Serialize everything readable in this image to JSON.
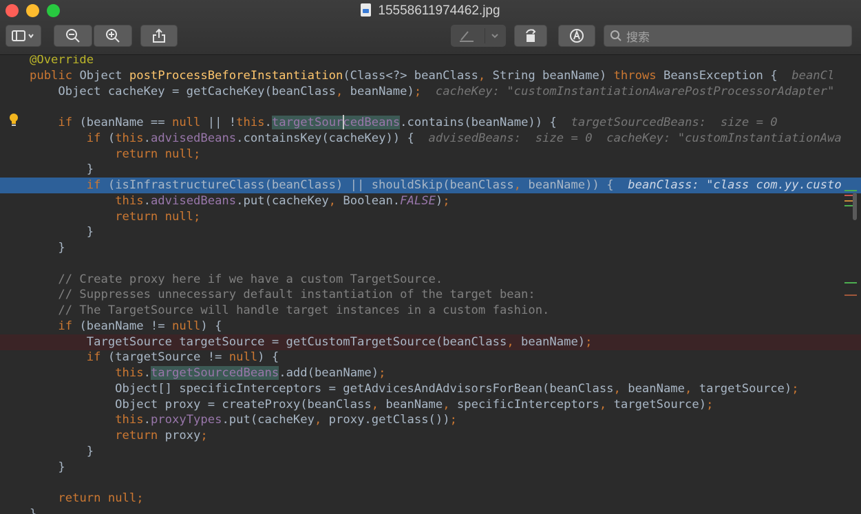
{
  "window": {
    "title": "15558611974462.jpg",
    "search_placeholder": "搜索"
  },
  "toolbar": {
    "icons": [
      "sidebar-icon",
      "zoom-out-icon",
      "zoom-in-icon",
      "share-icon",
      "markup-pen-icon",
      "rotate-icon",
      "annotate-icon"
    ]
  },
  "colors": {
    "keyword": "#cc7832",
    "method": "#ffc66d",
    "field": "#9876aa",
    "comment": "#808080",
    "annotation": "#bbb529",
    "exec_line": "#2d6099",
    "breakpoint_line": "#3b2426",
    "search_highlight": "#3c5a55"
  },
  "code": {
    "lines": [
      {
        "tokens": [
          {
            "c": "ann",
            "t": "@Override"
          }
        ]
      },
      {
        "tokens": [
          {
            "c": "kw",
            "t": "public "
          },
          {
            "c": "pl",
            "t": "Object "
          },
          {
            "c": "fn",
            "t": "postProcessBeforeInstantiation"
          },
          {
            "c": "pl",
            "t": "(Class<?> beanClass"
          },
          {
            "c": "kw",
            "t": ", "
          },
          {
            "c": "pl",
            "t": "String beanName) "
          },
          {
            "c": "kw",
            "t": "throws "
          },
          {
            "c": "pl",
            "t": "BeansException {  "
          },
          {
            "c": "hint",
            "t": "beanCl"
          }
        ]
      },
      {
        "tokens": [
          {
            "c": "pl",
            "t": "    Object cacheKey = getCacheKey(beanClass"
          },
          {
            "c": "kw",
            "t": ", "
          },
          {
            "c": "pl",
            "t": "beanName)"
          },
          {
            "c": "kw",
            "t": ";  "
          },
          {
            "c": "hint",
            "t": "cacheKey: \"customInstantiationAwarePostProcessorAdapter\""
          }
        ]
      },
      {
        "tokens": []
      },
      {
        "tokens": [
          {
            "c": "pl",
            "t": "    "
          },
          {
            "c": "kw",
            "t": "if "
          },
          {
            "c": "pl",
            "t": "(beanName == "
          },
          {
            "c": "kw",
            "t": "null "
          },
          {
            "c": "pl",
            "t": "|| !"
          },
          {
            "c": "kw",
            "t": "this"
          },
          {
            "c": "pl",
            "t": "."
          },
          {
            "c": "fld hl",
            "t": "targetSourcedBeans"
          },
          {
            "c": "pl",
            "t": ".contains(beanName)) {  "
          },
          {
            "c": "hint",
            "t": "targetSourcedBeans:  size = 0"
          }
        ]
      },
      {
        "tokens": [
          {
            "c": "pl",
            "t": "        "
          },
          {
            "c": "kw",
            "t": "if "
          },
          {
            "c": "pl",
            "t": "("
          },
          {
            "c": "kw",
            "t": "this"
          },
          {
            "c": "pl",
            "t": "."
          },
          {
            "c": "fld",
            "t": "advisedBeans"
          },
          {
            "c": "pl",
            "t": ".containsKey(cacheKey)) {  "
          },
          {
            "c": "hint",
            "t": "advisedBeans:  size = 0  cacheKey: \"customInstantiationAwa"
          }
        ]
      },
      {
        "tokens": [
          {
            "c": "pl",
            "t": "            "
          },
          {
            "c": "kw",
            "t": "return null;"
          }
        ]
      },
      {
        "tokens": [
          {
            "c": "pl",
            "t": "        }"
          }
        ]
      },
      {
        "tokens": [
          {
            "c": "pl",
            "t": "        "
          },
          {
            "c": "kw",
            "t": "if "
          },
          {
            "c": "pl",
            "t": "(isInfrastructureClass(beanClass) || shouldSkip(beanClass"
          },
          {
            "c": "kw",
            "t": ", "
          },
          {
            "c": "pl",
            "t": "beanName)) {  "
          },
          {
            "c": "hint",
            "t": "beanClass: \"class com.yy.custo"
          }
        ]
      },
      {
        "tokens": [
          {
            "c": "pl",
            "t": "            "
          },
          {
            "c": "kw",
            "t": "this"
          },
          {
            "c": "pl",
            "t": "."
          },
          {
            "c": "fld",
            "t": "advisedBeans"
          },
          {
            "c": "pl",
            "t": ".put(cacheKey"
          },
          {
            "c": "kw",
            "t": ", "
          },
          {
            "c": "pl",
            "t": "Boolean."
          },
          {
            "c": "cst",
            "t": "FALSE"
          },
          {
            "c": "pl",
            "t": ")"
          },
          {
            "c": "kw",
            "t": ";"
          }
        ]
      },
      {
        "tokens": [
          {
            "c": "pl",
            "t": "            "
          },
          {
            "c": "kw",
            "t": "return null;"
          }
        ]
      },
      {
        "tokens": [
          {
            "c": "pl",
            "t": "        }"
          }
        ]
      },
      {
        "tokens": [
          {
            "c": "pl",
            "t": "    }"
          }
        ]
      },
      {
        "tokens": []
      },
      {
        "tokens": [
          {
            "c": "cmt",
            "t": "    // Create proxy here if we have a custom TargetSource."
          }
        ]
      },
      {
        "tokens": [
          {
            "c": "cmt",
            "t": "    // Suppresses unnecessary default instantiation of the target bean:"
          }
        ]
      },
      {
        "tokens": [
          {
            "c": "cmt",
            "t": "    // The TargetSource will handle target instances in a custom fashion."
          }
        ]
      },
      {
        "tokens": [
          {
            "c": "pl",
            "t": "    "
          },
          {
            "c": "kw",
            "t": "if "
          },
          {
            "c": "pl",
            "t": "(beanName != "
          },
          {
            "c": "kw",
            "t": "null"
          },
          {
            "c": "pl",
            "t": ") {"
          }
        ]
      },
      {
        "tokens": [
          {
            "c": "pl",
            "t": "        TargetSource targetSource = getCustomTargetSource(beanClass"
          },
          {
            "c": "kw",
            "t": ", "
          },
          {
            "c": "pl",
            "t": "beanName)"
          },
          {
            "c": "kw",
            "t": ";"
          }
        ]
      },
      {
        "tokens": [
          {
            "c": "pl",
            "t": "        "
          },
          {
            "c": "kw",
            "t": "if "
          },
          {
            "c": "pl",
            "t": "(targetSource != "
          },
          {
            "c": "kw",
            "t": "null"
          },
          {
            "c": "pl",
            "t": ") {"
          }
        ]
      },
      {
        "tokens": [
          {
            "c": "pl",
            "t": "            "
          },
          {
            "c": "kw",
            "t": "this"
          },
          {
            "c": "pl",
            "t": "."
          },
          {
            "c": "fld hl",
            "t": "targetSourcedBeans"
          },
          {
            "c": "pl",
            "t": ".add(beanName)"
          },
          {
            "c": "kw",
            "t": ";"
          }
        ]
      },
      {
        "tokens": [
          {
            "c": "pl",
            "t": "            Object[] specificInterceptors = getAdvicesAndAdvisorsForBean(beanClass"
          },
          {
            "c": "kw",
            "t": ", "
          },
          {
            "c": "pl",
            "t": "beanName"
          },
          {
            "c": "kw",
            "t": ", "
          },
          {
            "c": "pl",
            "t": "targetSource)"
          },
          {
            "c": "kw",
            "t": ";"
          }
        ]
      },
      {
        "tokens": [
          {
            "c": "pl",
            "t": "            Object proxy = createProxy(beanClass"
          },
          {
            "c": "kw",
            "t": ", "
          },
          {
            "c": "pl",
            "t": "beanName"
          },
          {
            "c": "kw",
            "t": ", "
          },
          {
            "c": "pl",
            "t": "specificInterceptors"
          },
          {
            "c": "kw",
            "t": ", "
          },
          {
            "c": "pl",
            "t": "targetSource)"
          },
          {
            "c": "kw",
            "t": ";"
          }
        ]
      },
      {
        "tokens": [
          {
            "c": "pl",
            "t": "            "
          },
          {
            "c": "kw",
            "t": "this"
          },
          {
            "c": "pl",
            "t": "."
          },
          {
            "c": "fld",
            "t": "proxyTypes"
          },
          {
            "c": "pl",
            "t": ".put(cacheKey"
          },
          {
            "c": "kw",
            "t": ", "
          },
          {
            "c": "pl",
            "t": "proxy.getClass())"
          },
          {
            "c": "kw",
            "t": ";"
          }
        ]
      },
      {
        "tokens": [
          {
            "c": "pl",
            "t": "            "
          },
          {
            "c": "kw",
            "t": "return "
          },
          {
            "c": "pl",
            "t": "proxy"
          },
          {
            "c": "kw",
            "t": ";"
          }
        ]
      },
      {
        "tokens": [
          {
            "c": "pl",
            "t": "        }"
          }
        ]
      },
      {
        "tokens": [
          {
            "c": "pl",
            "t": "    }"
          }
        ]
      },
      {
        "tokens": []
      },
      {
        "tokens": [
          {
            "c": "pl",
            "t": "    "
          },
          {
            "c": "kw",
            "t": "return null;"
          }
        ]
      },
      {
        "tokens": [
          {
            "c": "pl",
            "t": "}"
          }
        ]
      }
    ],
    "execution_line_index": 8,
    "breakpoint_line_index": 18,
    "intention_bulb_line_index": 4
  }
}
